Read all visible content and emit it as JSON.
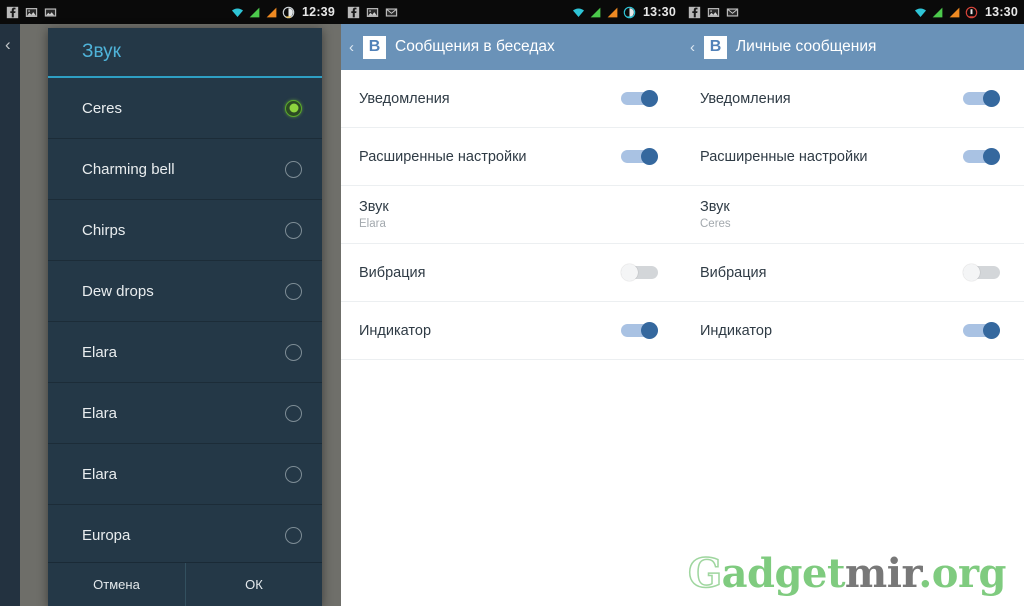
{
  "status_bars": {
    "left": {
      "time": "12:39",
      "icons": [
        "facebook-icon",
        "image-icon",
        "gallery-icon",
        "wifi-icon",
        "signal-icon",
        "signal-icon",
        "battery-icon"
      ]
    },
    "middle": {
      "time": "13:30",
      "icons": [
        "facebook-icon",
        "image-icon",
        "mail-icon",
        "wifi-icon",
        "signal-icon",
        "signal-icon",
        "battery-icon"
      ]
    },
    "right": {
      "time": "13:30",
      "icons": [
        "facebook-icon",
        "image-icon",
        "mail-icon",
        "wifi-icon",
        "signal-icon",
        "signal-icon",
        "battery-low-icon"
      ]
    }
  },
  "sound_dialog": {
    "title": "Звук",
    "items": [
      {
        "label": "Ceres",
        "selected": true
      },
      {
        "label": "Charming bell",
        "selected": false
      },
      {
        "label": "Chirps",
        "selected": false
      },
      {
        "label": "Dew drops",
        "selected": false
      },
      {
        "label": "Elara",
        "selected": false
      },
      {
        "label": "Elara",
        "selected": false
      },
      {
        "label": "Elara",
        "selected": false
      },
      {
        "label": "Europa",
        "selected": false
      }
    ],
    "cancel_label": "Отмена",
    "ok_label": "ОК"
  },
  "chat_settings": {
    "app_logo": "В",
    "title": "Сообщения в беседах",
    "rows": [
      {
        "title": "Уведомления",
        "sub": "",
        "toggle": "on"
      },
      {
        "title": "Расширенные настройки",
        "sub": "",
        "toggle": "on"
      },
      {
        "title": "Звук",
        "sub": "Elara",
        "toggle": "none"
      },
      {
        "title": "Вибрация",
        "sub": "",
        "toggle": "off"
      },
      {
        "title": "Индикатор",
        "sub": "",
        "toggle": "on"
      }
    ]
  },
  "private_settings": {
    "app_logo": "В",
    "title": "Личные сообщения",
    "rows": [
      {
        "title": "Уведомления",
        "sub": "",
        "toggle": "on"
      },
      {
        "title": "Расширенные настройки",
        "sub": "",
        "toggle": "on"
      },
      {
        "title": "Звук",
        "sub": "Ceres",
        "toggle": "none"
      },
      {
        "title": "Вибрация",
        "sub": "",
        "toggle": "off"
      },
      {
        "title": "Индикатор",
        "sub": "",
        "toggle": "on"
      }
    ]
  },
  "watermark": {
    "part_g": "G",
    "part_green": "adget",
    "part_gray": "mir",
    "part_org": ".org",
    "color_green": "#7fcb7f",
    "color_gray": "#787878"
  },
  "colors": {
    "dialog_bg": "#243847",
    "dialog_title": "#4fb3d9",
    "appbar": "#6a92b8",
    "toggle_on": "#35689e",
    "radio_on": "#8ed43e"
  }
}
